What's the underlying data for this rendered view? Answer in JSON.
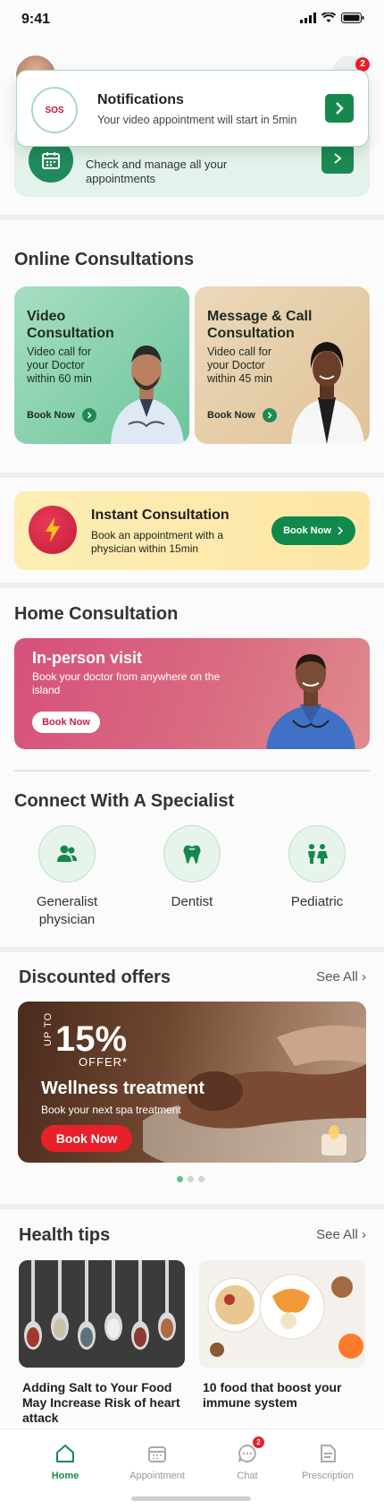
{
  "status_bar": {
    "time": "9:41"
  },
  "header": {
    "bell_badge": "2"
  },
  "appointments": {
    "subtitle": "Check and manage all your appointments"
  },
  "notification": {
    "logo_text": "SOS",
    "title": "Notifications",
    "message": "Your video appointment will start in 5min"
  },
  "online": {
    "title": "Online Consultations",
    "cards": [
      {
        "title": "Video Consultation",
        "subtitle": "Video call for your Doctor within 60 min",
        "cta": "Book Now"
      },
      {
        "title": "Message & Call Consultation",
        "subtitle": "Video call for your Doctor within 45 min",
        "cta": "Book Now"
      }
    ]
  },
  "instant": {
    "title": "Instant Consultation",
    "subtitle": "Book an appointment  with a physician within 15min",
    "cta": "Book Now"
  },
  "home": {
    "title": "Home Consultation",
    "banner_title": "In-person visit",
    "banner_subtitle": "Book your doctor from anywhere on the island",
    "cta": "Book Now"
  },
  "specialists": {
    "title": "Connect With A Specialist",
    "items": [
      {
        "label": "Generalist physician",
        "icon": "users-icon"
      },
      {
        "label": "Dentist",
        "icon": "tooth-icon"
      },
      {
        "label": "Pediatric",
        "icon": "children-icon"
      }
    ]
  },
  "offers": {
    "title": "Discounted offers",
    "see_all": "See All",
    "up_to": "UP TO",
    "percent": "15%",
    "offer": "OFFER*",
    "banner_title": "Wellness treatment",
    "banner_subtitle": "Book your next spa treatment",
    "cta": "Book Now"
  },
  "tips": {
    "title": "Health tips",
    "see_all": "See All",
    "items": [
      {
        "title": "Adding Salt to Your Food May Increase Risk of heart attack"
      },
      {
        "title": "10 food that boost your immune system"
      }
    ]
  },
  "nav": {
    "items": [
      {
        "label": "Home"
      },
      {
        "label": "Appointment"
      },
      {
        "label": "Chat",
        "badge": "2"
      },
      {
        "label": "Prescription"
      }
    ]
  },
  "colors": {
    "brand_green": "#15894d",
    "alert_red": "#e8202a"
  }
}
